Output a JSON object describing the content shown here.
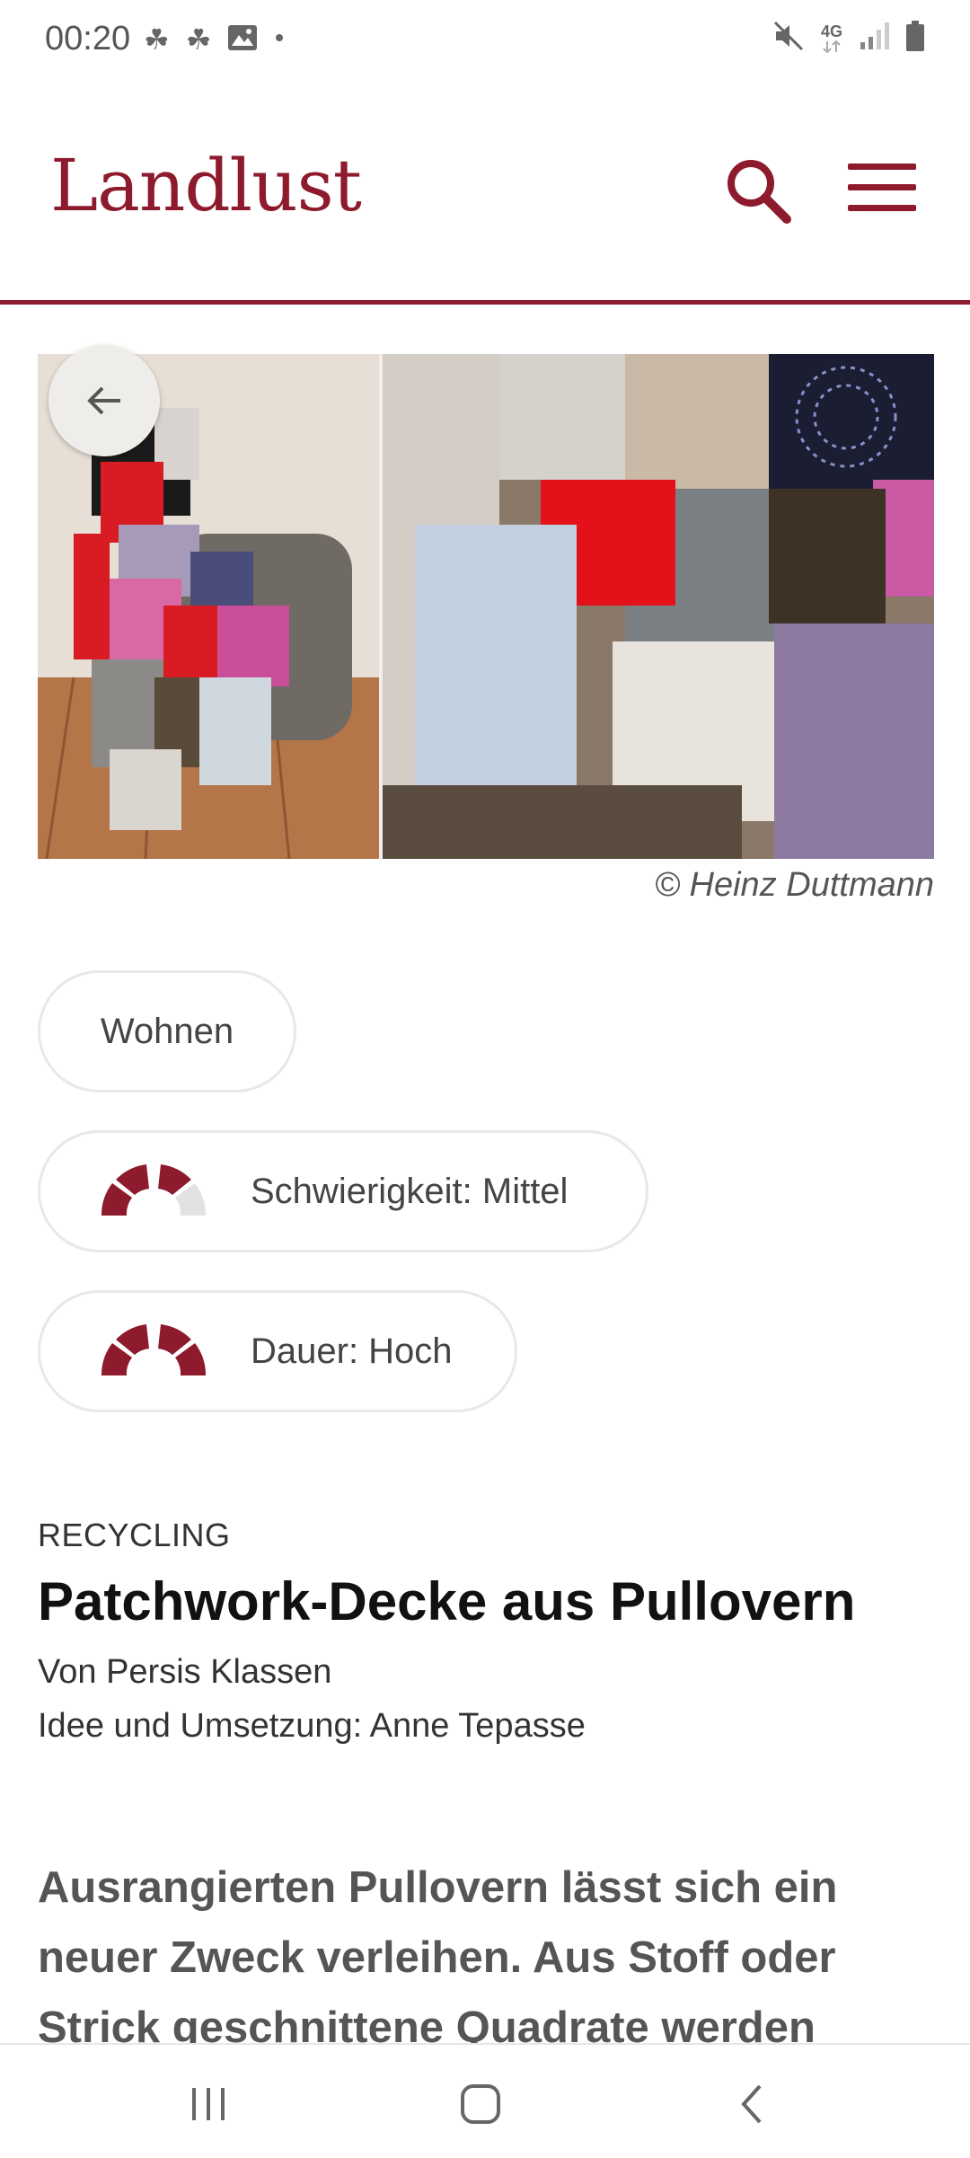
{
  "status_bar": {
    "time": "00:20",
    "left_icons": [
      "leaf-icon",
      "leaf-icon",
      "image-icon",
      "dot-icon"
    ],
    "network": "4G",
    "right_icons": [
      "mute-icon",
      "network-4g-icon",
      "signal-icon",
      "battery-icon"
    ]
  },
  "header": {
    "logo": "Landlust",
    "brand_color": "#8e1a2d"
  },
  "hero": {
    "credit": "©  Heinz Duttmann"
  },
  "tags": {
    "category": "Wohnen",
    "difficulty": {
      "label": "Schwierigkeit: Mittel",
      "level": 3,
      "max": 4
    },
    "duration": {
      "label": "Dauer: Hoch",
      "level": 4,
      "max": 4
    }
  },
  "article": {
    "category": "RECYCLING",
    "title": "Patchwork-Decke aus Pullovern",
    "author": "Von Persis Klassen",
    "idea": "Idee und Umsetzung: Anne Tepasse",
    "lead": "Ausrangierten Pullovern lässt sich ein neuer Zweck verleihen. Aus Stoff oder Strick geschnittene Quadrate werden"
  },
  "colors": {
    "accent": "#8e1a2d",
    "gauge_inactive": "#e2e2e2"
  }
}
